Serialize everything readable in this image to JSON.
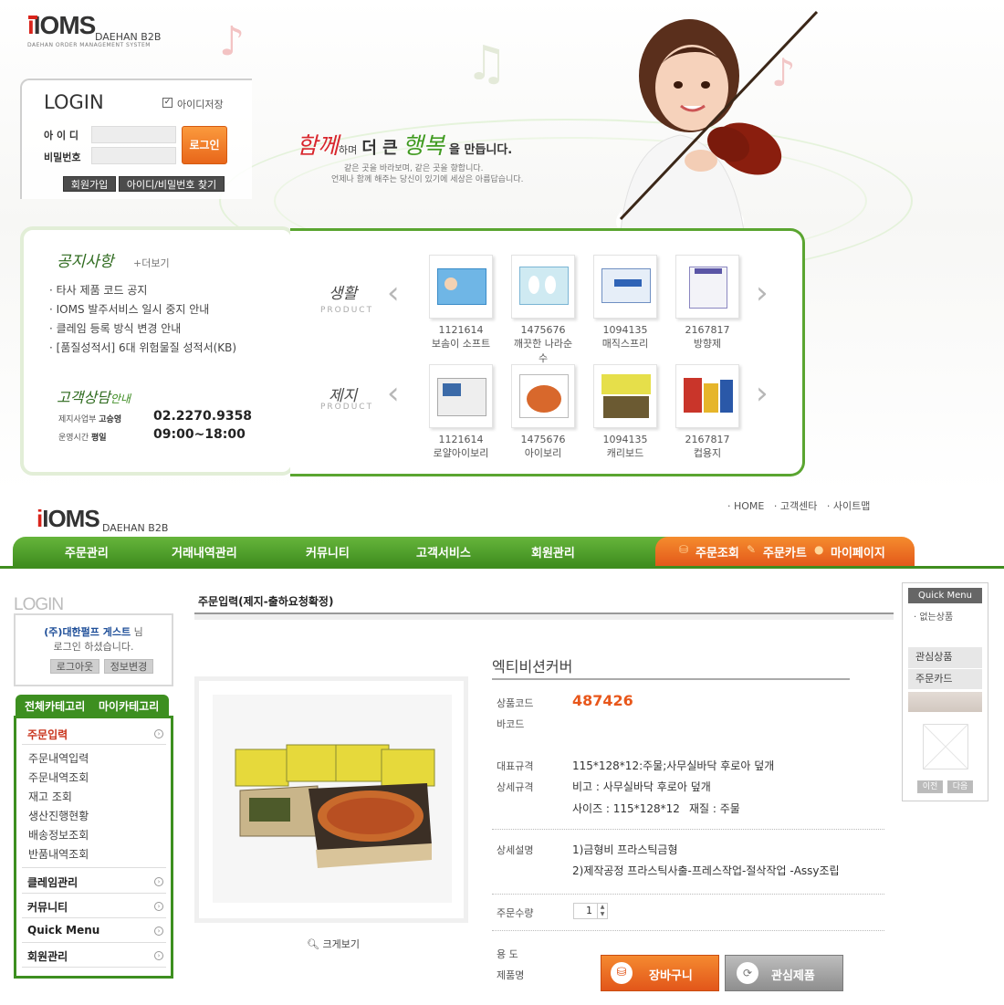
{
  "top": {
    "brand": "IOMS",
    "brand_sub": "DAEHAN B2B",
    "brand_desc": "DAEHAN ORDER MANAGEMENT SYSTEM",
    "login": {
      "title": "LOGIN",
      "remember_label": "아이디저장",
      "id_label": "아 이 디",
      "pw_label": "비밀번호",
      "login_button": "로그인",
      "join_button": "회원가입",
      "find_button": "아이디/비밀번호 찾기"
    },
    "slogan": {
      "w1": "함께",
      "w2": "하며",
      "w3": "더 큰",
      "w4": "행복",
      "w5": "을 만듭니다.",
      "line1": "같은 곳을 바라보며, 같은 곳을 향합니다.",
      "line2": "언제나 함께 해주는 당신이 있기에 세상은 아름답습니다."
    },
    "notice": {
      "title": "공지사항",
      "more": "+더보기",
      "items": [
        "타사 제품 코드 공지",
        "IOMS 발주서비스 일시 중지 안내",
        "클레임 등록 방식 변경 안내",
        "[품질성적서] 6대 위험물질 성적서(KB)"
      ],
      "cs_title": "고객상담",
      "cs_title2": "안내",
      "dept_label": "제지사업부",
      "dept_person": "고승영",
      "phone": "02.2270.9358",
      "hours_label": "운영시간",
      "hours_day": "평일",
      "hours": "09:00~18:00"
    },
    "products": {
      "row1_label": "생활",
      "row1_sub": "PRODUCT",
      "row2_label": "제지",
      "row2_sub": "PRODUCT",
      "row1": [
        {
          "code": "1121614",
          "name": "보솜이 소프트"
        },
        {
          "code": "1475676",
          "name": "깨끗한 나라순수"
        },
        {
          "code": "1094135",
          "name": "매직스프리"
        },
        {
          "code": "2167817",
          "name": "방향제"
        }
      ],
      "row2": [
        {
          "code": "1121614",
          "name": "로얄아이보리"
        },
        {
          "code": "1475676",
          "name": "아이보리"
        },
        {
          "code": "1094135",
          "name": "캐리보드"
        },
        {
          "code": "2167817",
          "name": "컵용지"
        }
      ]
    }
  },
  "header": {
    "brand": "IOMS",
    "brand_sub": "DAEHAN B2B",
    "util": [
      "· HOME",
      "· 고객센타",
      "· 사이트맵"
    ],
    "nav": [
      "주문관리",
      "거래내역관리",
      "커뮤니티",
      "고객서비스",
      "회원관리"
    ],
    "nav_right": [
      "주문조회",
      "주문카트",
      "마이페이지"
    ]
  },
  "sidebar": {
    "login_title": "LOGIN",
    "user": "(주)대한펄프 게스트",
    "user_suffix": "님",
    "greeting": "로그인 하셨습니다.",
    "logout": "로그아웃",
    "edit": "정보변경",
    "tab_all": "전체카테고리",
    "tab_my": "마이카테고리",
    "menu_order": "주문입력",
    "order_items": [
      "주문내역입력",
      "주문내역조회",
      "재고 조회",
      "생산진행현황",
      "배송정보조회",
      "반품내역조회"
    ],
    "menus": [
      "클레임관리",
      "커뮤니티",
      "Quick Menu",
      "회원관리"
    ]
  },
  "main": {
    "page_title": "주문입력(제지-출하요청확정)",
    "product_name": "엑티비션커버",
    "zoom": "크게보기",
    "code_label": "상품코드",
    "code": "487426",
    "barcode_label": "바코드",
    "spec_label": "대표규격",
    "spec": "115*128*12:주물;사무실바닥 후로아 덮개",
    "detail_spec_label": "상세규격",
    "detail_spec1": "비고 : 사무실바닥 후로아 덮개",
    "detail_spec2a": "사이즈 : 115*128*12",
    "detail_spec2b": "재질 : 주물",
    "desc_label": "상세설명",
    "desc1": "1)금형비 프라스틱금형",
    "desc2": "2)제작공정 프라스틱사출-프레스작업-절삭작업 -Assy조립",
    "qty_label": "주문수량",
    "qty": "1",
    "use_label": "용 도",
    "prodname_label": "제품명",
    "cart_button": "장바구니",
    "wish_button": "관심제품"
  },
  "quick": {
    "title": "Quick Menu",
    "none": "· 없는상품",
    "fav": "관심상품",
    "card": "주문카드",
    "prev": "이전",
    "next": "다음"
  }
}
